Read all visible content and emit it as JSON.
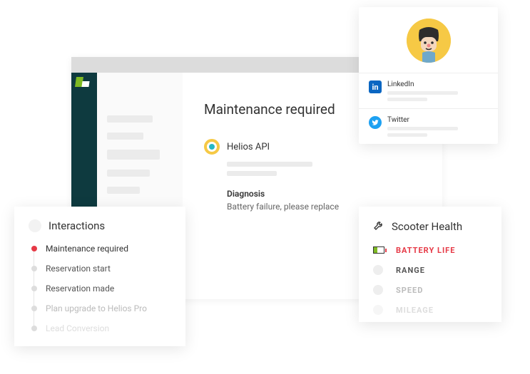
{
  "main": {
    "title": "Maintenance required",
    "api_name": "Helios API",
    "diagnosis_label": "Diagnosis",
    "diagnosis_text": "Battery failure, please replace"
  },
  "social": {
    "items": [
      {
        "label": "LinkedIn"
      },
      {
        "label": "Twitter"
      }
    ]
  },
  "interactions": {
    "title": "Interactions",
    "items": [
      {
        "label": "Maintenance required",
        "state": "active"
      },
      {
        "label": "Reservation start",
        "state": "normal"
      },
      {
        "label": "Reservation made",
        "state": "normal"
      },
      {
        "label": "Plan upgrade to Helios Pro",
        "state": "fade2"
      },
      {
        "label": "Lead Conversion",
        "state": "fade3"
      }
    ]
  },
  "health": {
    "title": "Scooter Health",
    "metrics": [
      {
        "label": "BATTERY LIFE",
        "state": "alert"
      },
      {
        "label": "RANGE",
        "state": "normal"
      },
      {
        "label": "SPEED",
        "state": "fade2"
      },
      {
        "label": "MILEAGE",
        "state": "fade3"
      }
    ]
  }
}
